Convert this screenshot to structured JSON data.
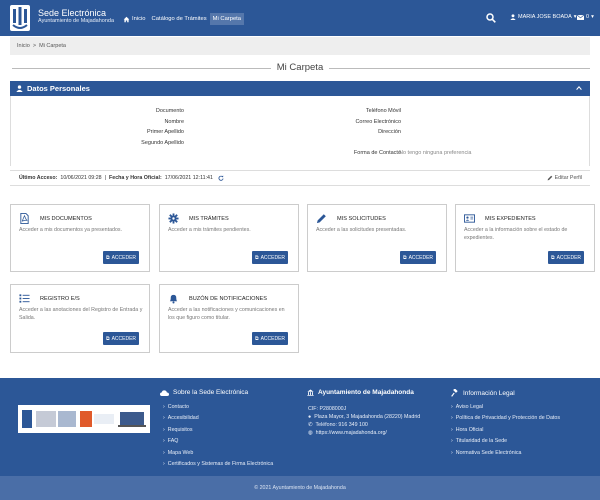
{
  "header": {
    "brand_title": "Sede Electrónica",
    "brand_subtitle": "Ayuntamiento de Majadahonda",
    "nav": [
      {
        "label": "Inicio"
      },
      {
        "label": "Catálogo de Trámites"
      },
      {
        "label": "Mi Carpeta"
      }
    ],
    "user_name": "MARIA JOSE BOADA",
    "mail_count": "0"
  },
  "breadcrumb": {
    "home": "Inicio",
    "separator": ">",
    "current": "Mi Carpeta"
  },
  "page_title": "Mi Carpeta",
  "datos": {
    "title": "Datos Personales",
    "left_fields": [
      "Documento",
      "Nombre",
      "Primer Apellido",
      "Segundo Apellido"
    ],
    "right_fields": [
      "Teléfono Móvil",
      "Correo Electrónico",
      "Dirección"
    ],
    "contact_label": "Forma de Contacto",
    "contact_value": "No tengo ninguna preferencia"
  },
  "access": {
    "last_label": "Último Acceso:",
    "last_value": "10/06/2021 09:28",
    "sep": "|",
    "official_label": "Fecha y Hora Oficial:",
    "official_value": "17/06/2021 12:11:41",
    "edit_label": "Editar Perfil"
  },
  "cards": [
    {
      "title": "MIS DOCUMENTOS",
      "desc": "Acceder a mis documentos ya presentados.",
      "button": "ACCEDER"
    },
    {
      "title": "MIS TRÁMITES",
      "desc": "Acceder a mis trámites pendientes.",
      "button": "ACCEDER"
    },
    {
      "title": "MIS SOLICITUDES",
      "desc": "Acceder a las solicitudes presentadas.",
      "button": "ACCEDER"
    },
    {
      "title": "MIS EXPEDIENTES",
      "desc": "Acceder a la información sobre el estado de expedientes.",
      "button": "ACCEDER"
    },
    {
      "title": "REGISTRO E/S",
      "desc": "Acceder a las anotaciones del Registro de Entrada y Salida.",
      "button": "ACCEDER"
    },
    {
      "title": "BUZÓN DE NOTIFICACIONES",
      "desc": "Acceder a las notificaciones y comunicaciones en los que figuro como titular.",
      "button": "ACCEDER"
    }
  ],
  "footer": {
    "col1_title": "Sobre la Sede Electrónica",
    "col1_links": [
      "Contacto",
      "Accesibilidad",
      "Requisitos",
      "FAQ",
      "Mapa Web",
      "Certificados y Sistemas de Firma Electrónica"
    ],
    "col2_title": "Ayuntamiento de Majadahonda",
    "cif": "CIF: P2808000J",
    "address": "Plaza Mayor, 3 Majadahonda (28220) Madrid",
    "phone": "Teléfono: 916 349 100",
    "web": "https://www.majadahonda.org/",
    "col3_title": "Información Legal",
    "col3_links": [
      "Aviso Legal",
      "Política de Privacidad y Protección de Datos",
      "Hora Oficial",
      "Titularidad de la Sede",
      "Normativa Sede Electrónica"
    ],
    "copyright": "© 2021 Ayuntamiento de Majadahonda"
  },
  "colors": {
    "primary": "#2c5797",
    "footer_bottom": "#4a6ea7",
    "breadcrumb_bg": "#eeeeee"
  }
}
